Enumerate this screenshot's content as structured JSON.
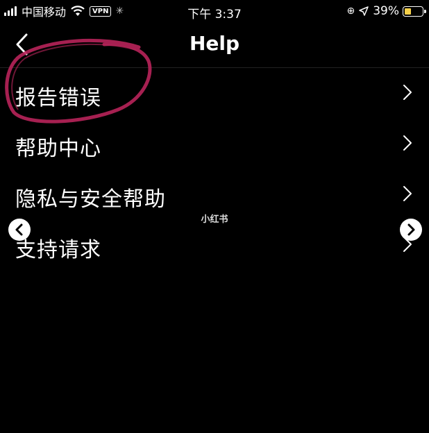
{
  "status_bar": {
    "carrier": "中国移动",
    "vpn": "VPN",
    "time": "下午 3:37",
    "battery_percent": "39%",
    "battery_level": 0.39,
    "battery_color": "#f7d14a"
  },
  "nav": {
    "title": "Help",
    "back_icon": "chevron-left-icon"
  },
  "menu": {
    "items": [
      {
        "label": "报告错误",
        "icon": "chevron-right-icon"
      },
      {
        "label": "帮助中心",
        "icon": "chevron-right-icon"
      },
      {
        "label": "隐私与安全帮助",
        "icon": "chevron-right-icon"
      },
      {
        "label": "支持请求",
        "icon": "chevron-right-icon"
      }
    ]
  },
  "overlay": {
    "watermark": "小红书",
    "annotation_color": "#b8245a"
  }
}
